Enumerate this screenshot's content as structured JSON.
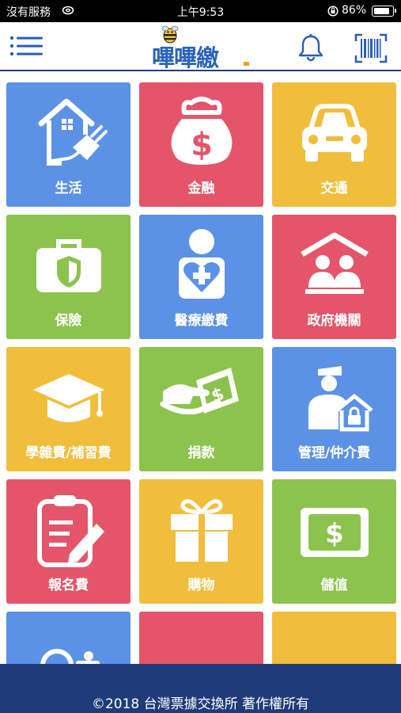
{
  "status_bar": {
    "carrier": "沒有服務",
    "time": "上午9:53",
    "battery_pct": "86%",
    "battery_level": 0.86
  },
  "header": {
    "logo_text": "嗶嗶繳",
    "menu_icon": "hamburger-menu-icon",
    "bell_icon": "bell-icon",
    "scan_icon": "barcode-scan-icon"
  },
  "colors": {
    "blue": "#5b92e6",
    "red": "#e4556a",
    "yellow": "#f1be3c",
    "green": "#8cc34c",
    "navy": "#1f3c7a"
  },
  "tiles": [
    {
      "label": "生活",
      "icon": "home-plug-icon",
      "color": "#5b92e6"
    },
    {
      "label": "金融",
      "icon": "money-bag-icon",
      "color": "#e4556a"
    },
    {
      "label": "交通",
      "icon": "car-icon",
      "color": "#f1be3c"
    },
    {
      "label": "保險",
      "icon": "shield-briefcase-icon",
      "color": "#8cc34c"
    },
    {
      "label": "醫療繳費",
      "icon": "medical-person-icon",
      "color": "#5b92e6"
    },
    {
      "label": "政府機關",
      "icon": "government-building-icon",
      "color": "#e4556a"
    },
    {
      "label": "學雜費/補習費",
      "icon": "graduation-cap-icon",
      "color": "#f1be3c"
    },
    {
      "label": "捐款",
      "icon": "donation-hand-icon",
      "color": "#8cc34c"
    },
    {
      "label": "管理/仲介費",
      "icon": "agent-house-icon",
      "color": "#5b92e6"
    },
    {
      "label": "報名費",
      "icon": "clipboard-pen-icon",
      "color": "#e4556a"
    },
    {
      "label": "購物",
      "icon": "gift-box-icon",
      "color": "#f1be3c"
    },
    {
      "label": "儲值",
      "icon": "dollar-card-icon",
      "color": "#8cc34c"
    },
    {
      "label": "",
      "icon": "camera-icon",
      "color": "#5b92e6"
    },
    {
      "label": "",
      "icon": "more-dots-icon",
      "color": "#e4556a"
    },
    {
      "label": "",
      "icon": "more-dots-icon",
      "color": "#f1be3c"
    }
  ],
  "footer": {
    "copyright": "©2018 台灣票據交換所 著作權所有"
  }
}
